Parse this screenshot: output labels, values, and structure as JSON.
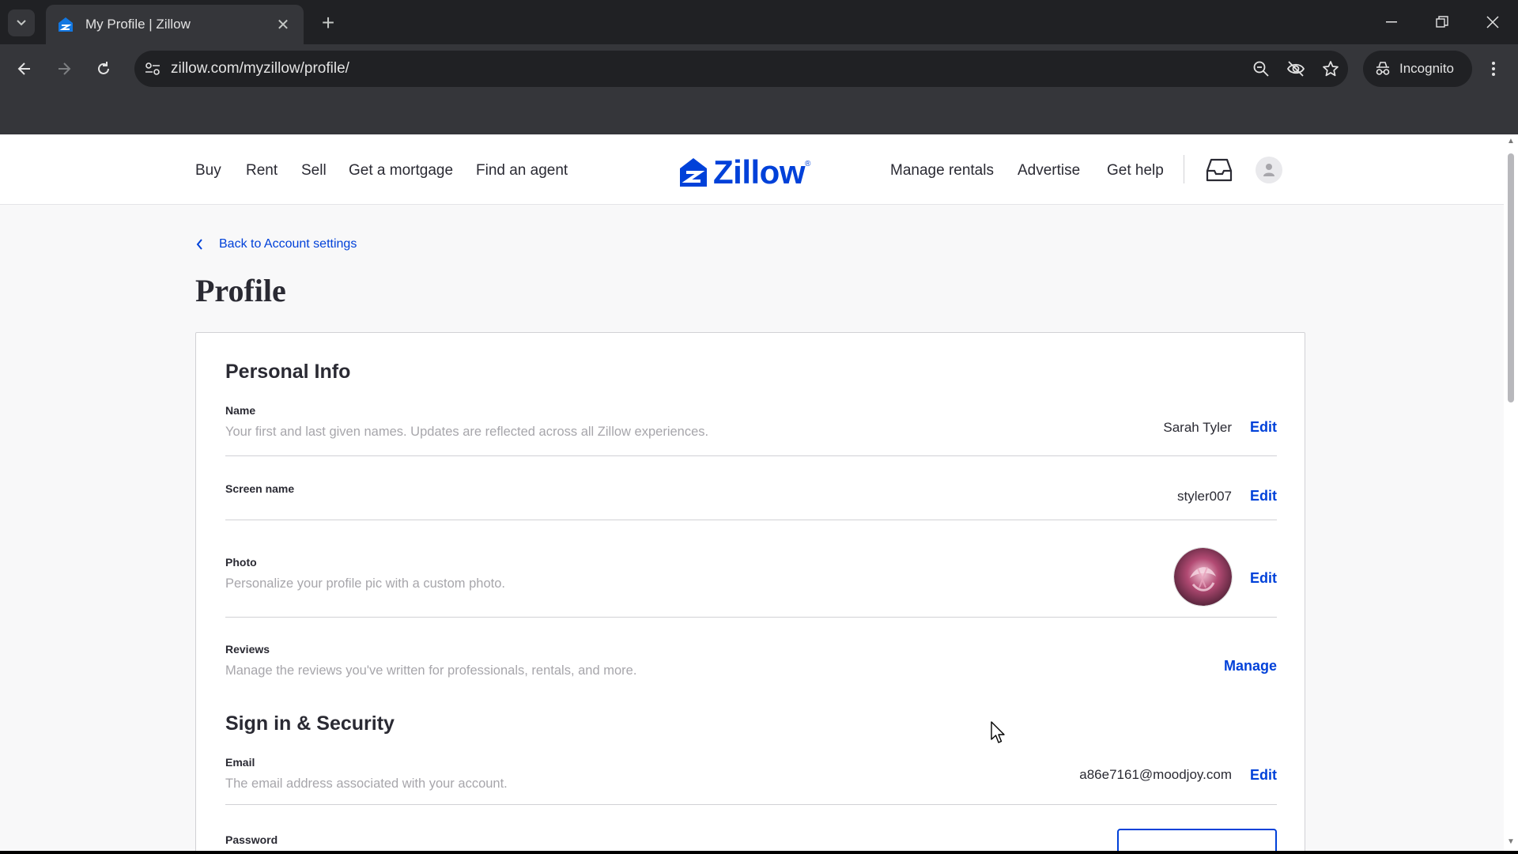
{
  "browser": {
    "tab_title": "My Profile | Zillow",
    "url": "zillow.com/myzillow/profile/",
    "incognito_label": "Incognito",
    "icons": [
      "tab-search-icon",
      "close-icon",
      "plus-icon",
      "minimize-icon",
      "restore-icon",
      "window-close-icon",
      "back-arrow-icon",
      "forward-arrow-icon",
      "reload-icon",
      "site-settings-icon",
      "zoom-icon",
      "eye-off-icon",
      "star-icon",
      "incognito-icon",
      "menu-dots-icon"
    ]
  },
  "header": {
    "nav_left": [
      "Buy",
      "Rent",
      "Sell",
      "Get a mortgage",
      "Find an agent"
    ],
    "logo_text": "Zillow",
    "logo_reg": "®",
    "nav_right": [
      "Manage rentals",
      "Advertise",
      "Get help"
    ],
    "icons": [
      "inbox-icon",
      "user-avatar-icon"
    ]
  },
  "back_link": "Back to Account settings",
  "page_title": "Profile",
  "personal_info": {
    "title": "Personal Info",
    "name": {
      "label": "Name",
      "description": "Your first and last given names. Updates are reflected across all Zillow experiences.",
      "value": "Sarah Tyler",
      "action": "Edit"
    },
    "screen_name": {
      "label": "Screen name",
      "value": "styler007",
      "action": "Edit"
    },
    "photo": {
      "label": "Photo",
      "description": "Personalize your profile pic with a custom photo.",
      "action": "Edit"
    },
    "reviews": {
      "label": "Reviews",
      "description": "Manage the reviews you've written for professionals, rentals, and more.",
      "action": "Manage"
    }
  },
  "security": {
    "title": "Sign in & Security",
    "email": {
      "label": "Email",
      "description": "The email address associated with your account.",
      "value": "a86e7161@moodjoy.com",
      "action": "Edit"
    },
    "password": {
      "label": "Password"
    }
  },
  "colors": {
    "brand_blue": "#0041d9",
    "text": "#2a2a33",
    "muted": "#a7a6ab"
  }
}
